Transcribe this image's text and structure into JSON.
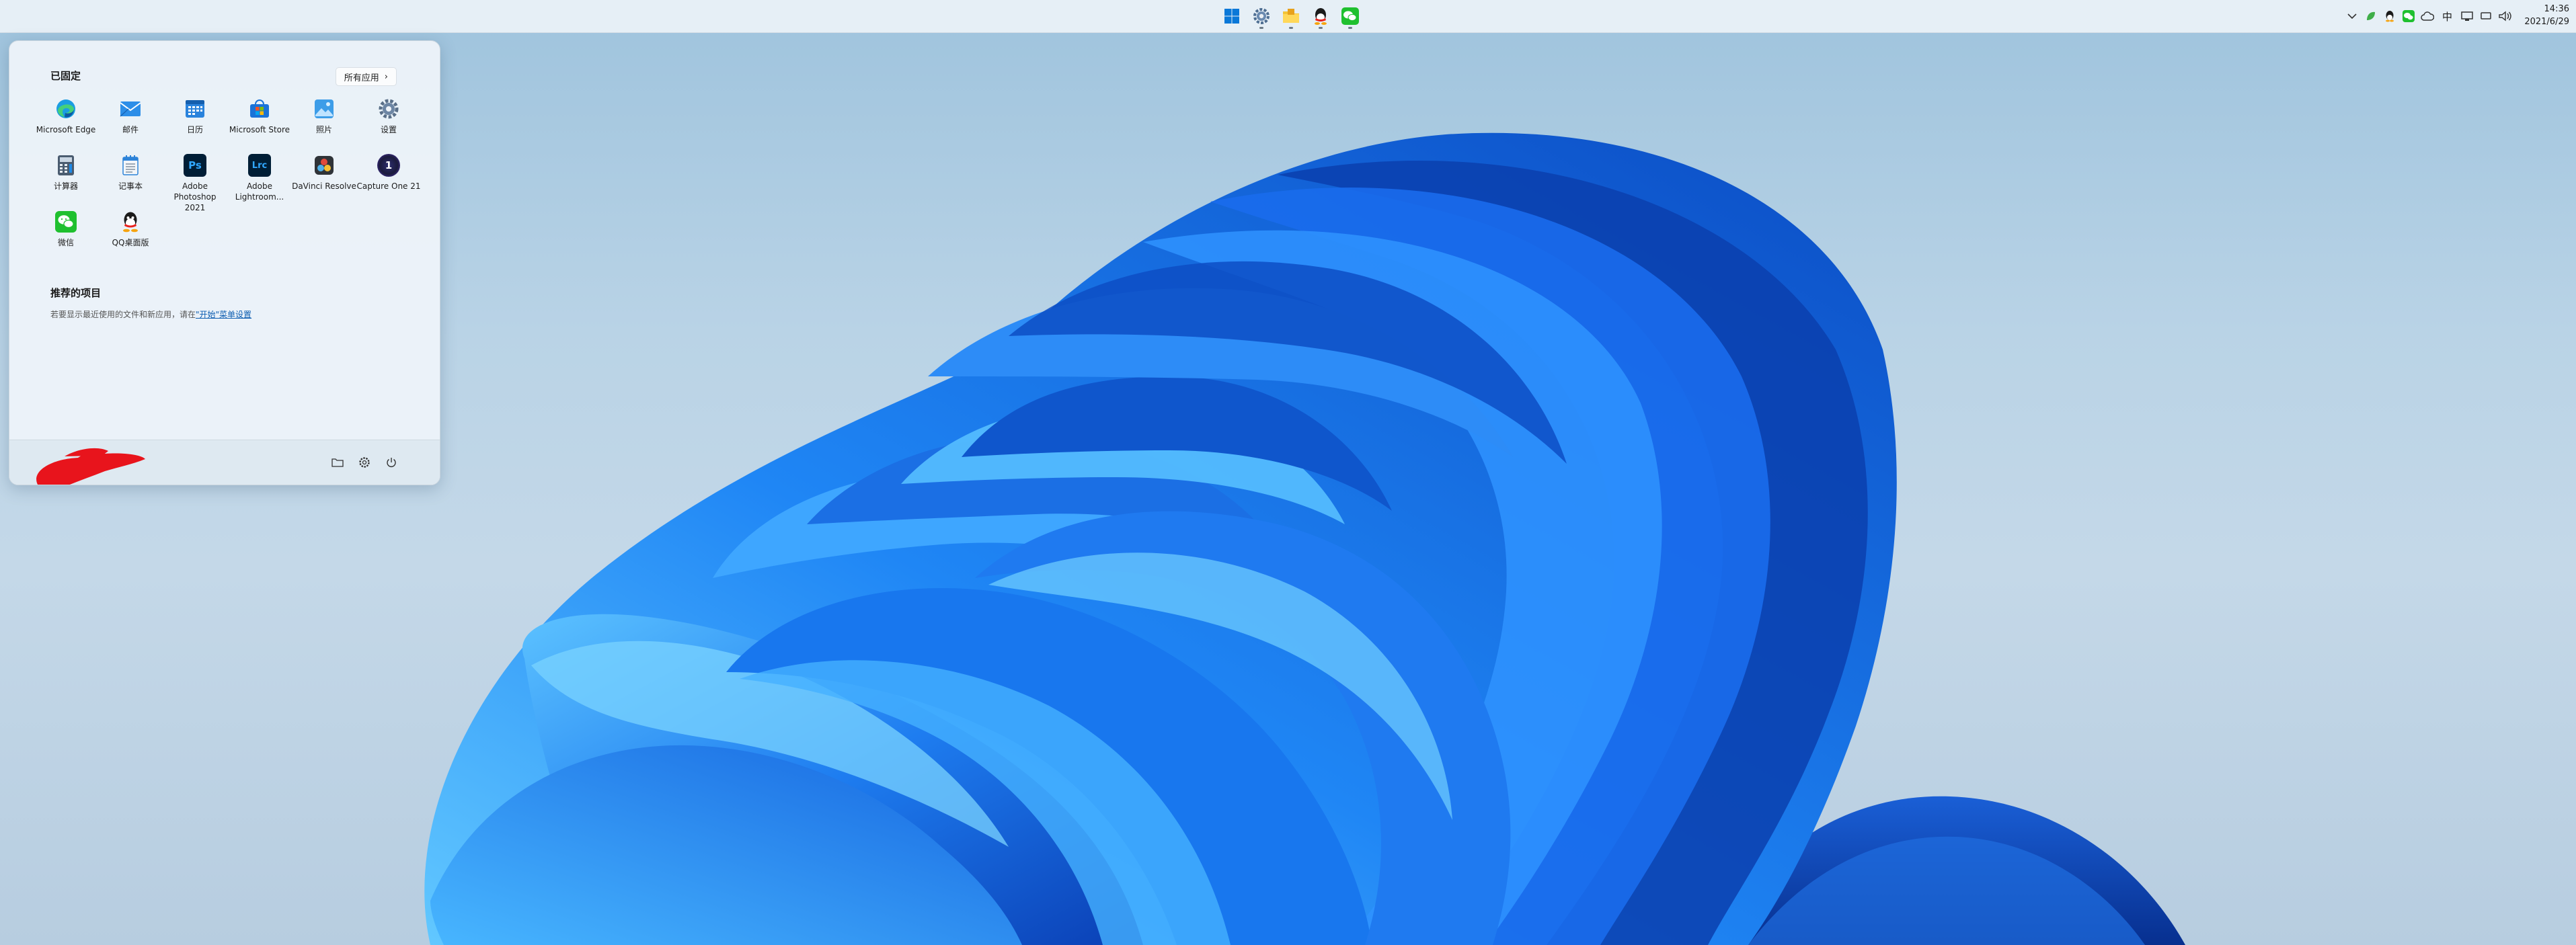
{
  "taskbar": {
    "center_apps": [
      {
        "icon": "windows-start-icon",
        "running": false
      },
      {
        "icon": "settings-app-icon",
        "running": true
      },
      {
        "icon": "file-explorer-icon",
        "running": true
      },
      {
        "icon": "qq-icon",
        "running": true
      },
      {
        "icon": "wechat-icon",
        "running": true
      }
    ],
    "tray": {
      "ime_label": "中",
      "icons": [
        "chevron-up-icon",
        "leaf-icon",
        "qq-tray-icon",
        "wechat-tray-icon",
        "cloud-icon",
        "network-icon",
        "display-icon",
        "volume-icon"
      ]
    },
    "clock": {
      "time": "14:36",
      "date": "2021/6/29"
    }
  },
  "start_menu": {
    "pinned_title": "已固定",
    "all_apps_label": "所有应用",
    "all_apps_chevron": "›",
    "pinned_apps": [
      {
        "label": "Microsoft Edge",
        "icon": "edge-icon"
      },
      {
        "label": "邮件",
        "icon": "mail-icon"
      },
      {
        "label": "日历",
        "icon": "calendar-icon"
      },
      {
        "label": "Microsoft Store",
        "icon": "store-icon"
      },
      {
        "label": "照片",
        "icon": "photos-icon"
      },
      {
        "label": "设置",
        "icon": "settings-icon"
      },
      {
        "label": "计算器",
        "icon": "calculator-icon"
      },
      {
        "label": "记事本",
        "icon": "notepad-icon"
      },
      {
        "label": "Adobe Photoshop 2021",
        "icon": "photoshop-icon",
        "abbr": "Ps"
      },
      {
        "label": "Adobe Lightroom...",
        "icon": "lightroom-icon",
        "abbr": "Lrc"
      },
      {
        "label": "DaVinci Resolve",
        "icon": "davinci-resolve-icon"
      },
      {
        "label": "Capture One 21",
        "icon": "capture-one-icon",
        "abbr": "1"
      },
      {
        "label": "微信",
        "icon": "wechat-icon"
      },
      {
        "label": "QQ桌面版",
        "icon": "qq-icon"
      }
    ],
    "recommended_title": "推荐的项目",
    "recommended_text": "若要显示最近使用的文件和新应用，请在",
    "recommended_link": "\"开始\"菜单设置",
    "footer": {
      "buttons": [
        "folder-icon",
        "gear-icon",
        "power-icon"
      ]
    }
  },
  "colors": {
    "accent": "#0067c0",
    "wallpaper_blue": "#1a75e8",
    "scribble_red": "#e8141c"
  }
}
